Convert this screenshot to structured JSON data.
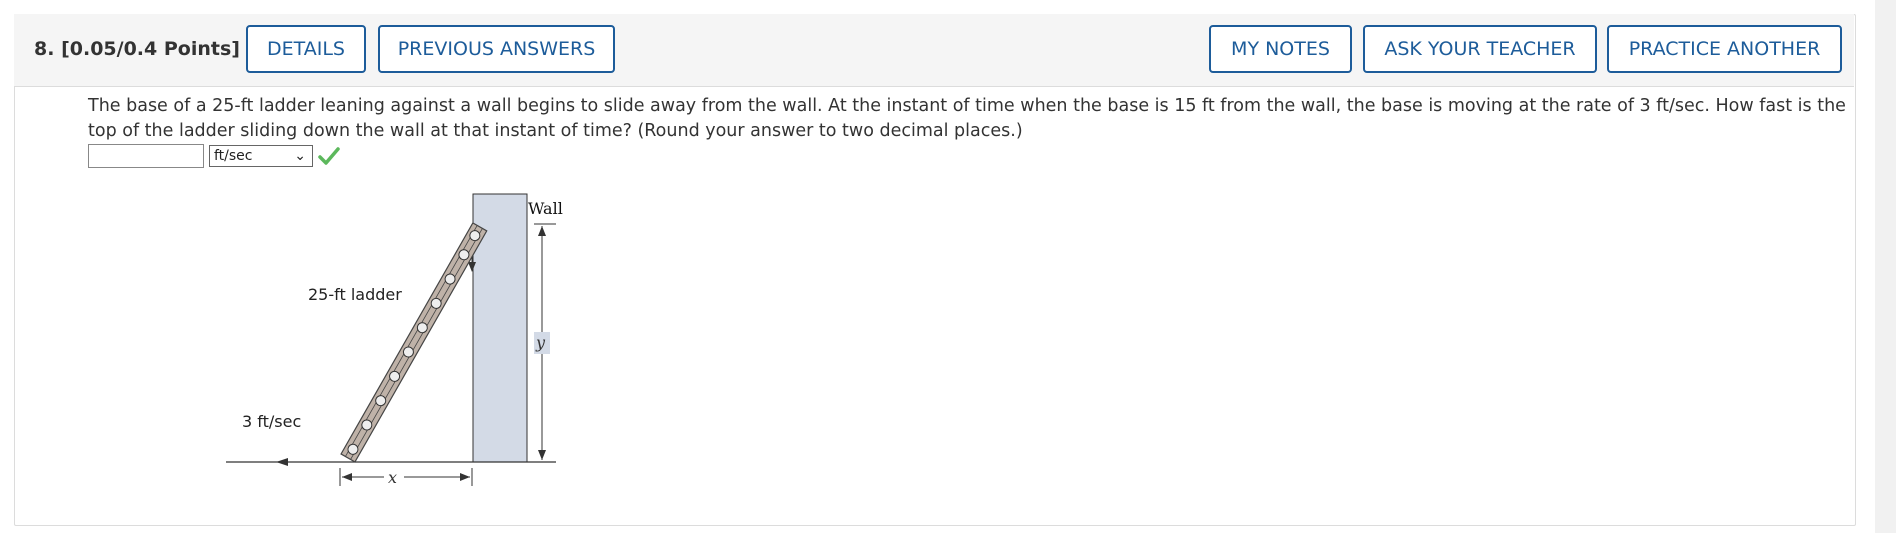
{
  "header": {
    "question_number": "8.",
    "points": "[0.05/0.4 Points]",
    "buttons": {
      "details": "DETAILS",
      "previous_answers": "PREVIOUS ANSWERS",
      "my_notes": "MY NOTES",
      "ask_your_teacher": "ASK YOUR TEACHER",
      "practice_another": "PRACTICE ANOTHER"
    }
  },
  "question": {
    "text": "The base of a 25-ft ladder leaning against a wall begins to slide away from the wall. At the instant of time when the base is 15 ft from the wall, the base is moving at the rate of 3 ft/sec. How fast is the top of the ladder sliding down the wall at that instant of time? (Round your answer to two decimal places.)",
    "answer_value": "",
    "unit_selected": "ft/sec",
    "status": "correct"
  },
  "figure": {
    "wall_label": "Wall",
    "ladder_label": "25-ft ladder",
    "rate_label": "3 ft/sec",
    "x_label": "x",
    "y_label": "y"
  },
  "colors": {
    "accent": "#1d5c9a",
    "check": "#5cb85c",
    "wall_fill": "#d3dae6"
  }
}
